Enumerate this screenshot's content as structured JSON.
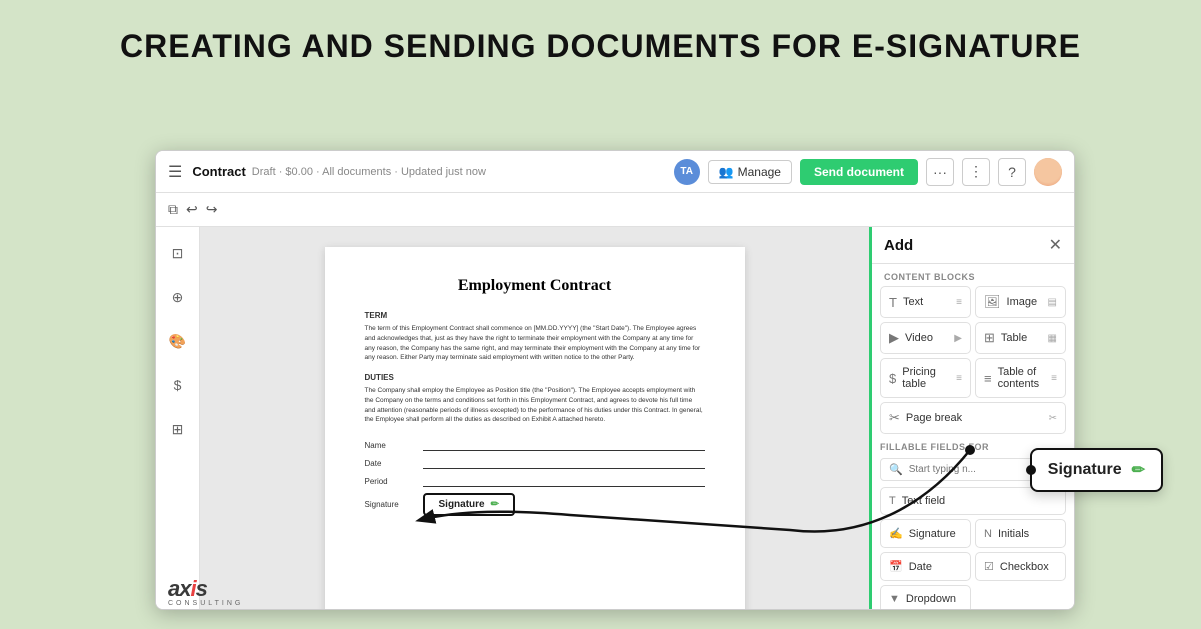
{
  "page": {
    "title": "CREATING AND SENDING DOCUMENTS FOR E-SIGNATURE",
    "bg_color": "#d4e4c8"
  },
  "top_bar": {
    "doc_title": "Contract",
    "doc_meta": "Draft · $0.00 · All documents · Updated just now",
    "avatar_initials": "TA",
    "manage_label": "Manage",
    "send_label": "Send document"
  },
  "add_panel": {
    "title": "Add",
    "close_icon": "✕",
    "sections": {
      "content_blocks_label": "CONTENT BLOCKS",
      "blocks": [
        {
          "id": "text",
          "label": "Text",
          "icon": "T"
        },
        {
          "id": "image",
          "label": "Image",
          "icon": "🖼"
        },
        {
          "id": "video",
          "label": "Video",
          "icon": "▶"
        },
        {
          "id": "table",
          "label": "Table",
          "icon": "⊞"
        },
        {
          "id": "pricing-table",
          "label": "Pricing table",
          "icon": "$="
        },
        {
          "id": "toc",
          "label": "Table of contents",
          "icon": "≡"
        },
        {
          "id": "page-break",
          "label": "Page break",
          "icon": "✂"
        }
      ],
      "fillable_label": "FILLABLE FIELDS FOR",
      "search_placeholder": "Start typing n...",
      "fillable_items": [
        {
          "id": "text-field",
          "label": "Text field",
          "icon": "T"
        },
        {
          "id": "signature",
          "label": "Signature",
          "icon": "✍"
        },
        {
          "id": "initials",
          "label": "Initials",
          "icon": "N"
        },
        {
          "id": "date",
          "label": "Date",
          "icon": "📅"
        },
        {
          "id": "checkbox",
          "label": "Checkbox",
          "icon": "☑"
        },
        {
          "id": "dropdown",
          "label": "Dropdown",
          "icon": "▼"
        }
      ]
    }
  },
  "document": {
    "heading": "Employment  Contract",
    "sections": [
      {
        "label": "TERM",
        "text": "The term of this Employment Contract shall commence on [MM.DD.YYYY]\n(the \"Start Date\"). The Employee agrees and acknowledges that, just as they have the right to terminate\ntheir employment with the Company at any time for any reason, the Company has the same right, and may\nterminate their employment with the Company at any time for any reason. Either Party may terminate said\nemployment with written notice to the other Party."
      },
      {
        "label": "DUTIES",
        "text": "The Company shall employ the Employee as Position title (the \"Position\").\nThe Employee accepts employment with the Company on the terms and conditions set forth in this\nEmployment Contract, and agrees to devote his full time and attention (reasonable periods of illness\nexcepted) to the performance of his duties under this Contract. In general, the Employee shall perform all\nthe duties as described on Exhibit A attached hereto."
      }
    ],
    "fields": [
      {
        "label": "Name"
      },
      {
        "label": "Date"
      },
      {
        "label": "Period"
      }
    ],
    "signature_label": "Signature",
    "signature_box_text": "Signature"
  },
  "signature_tooltip": {
    "text": "Signature",
    "edit_icon": "✏"
  },
  "axis_logo": {
    "name": "axis",
    "sub": "CONSULTING"
  }
}
